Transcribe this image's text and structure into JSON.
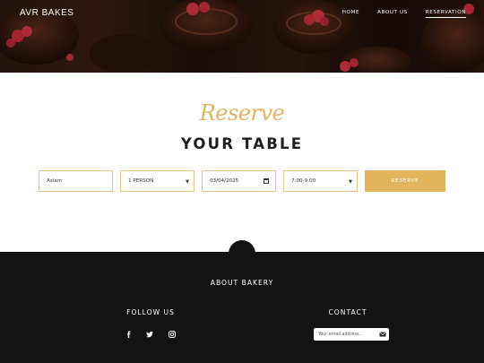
{
  "header": {
    "brand": "AVR BAKES",
    "nav": [
      "HOME",
      "ABOUT US",
      "RESERVATION"
    ],
    "active_nav": "RESERVATION"
  },
  "reserve": {
    "script_title": "Reserve",
    "title": "YOUR TABLE",
    "name_value": "Aslam",
    "person_value": "1 PERSON",
    "date_value": "03/04/2025",
    "time_value": "7:00-9:00",
    "button_label": "RESERVE"
  },
  "footer": {
    "about_label": "ABOUT BAKERY",
    "follow_label": "FOLLOW US",
    "contact_label": "CONTACT",
    "email_placeholder": "Your email address...",
    "social_icons": [
      "facebook-icon",
      "twitter-icon",
      "instagram-icon"
    ]
  },
  "colors": {
    "accent": "#e2b45e",
    "footer_bg": "#131313",
    "title_text": "#1f1f1f"
  }
}
